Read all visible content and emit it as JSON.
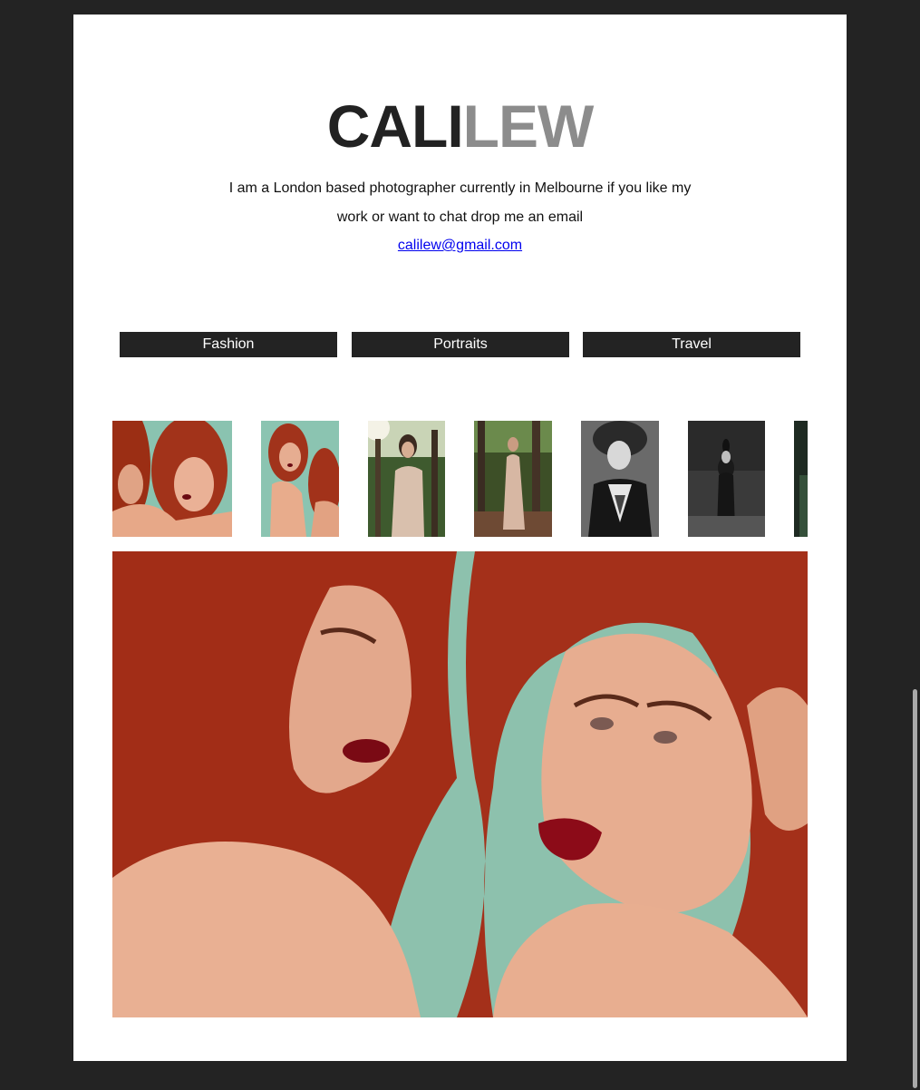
{
  "header": {
    "logo_first": "CALI",
    "logo_second": "LEW",
    "intro_line1": "I am a London based photographer currently in Melbourne if you like my",
    "intro_line2": "work or want to chat drop me an email",
    "email": "calilew@gmail.com"
  },
  "nav": {
    "items": [
      {
        "label": "Fashion"
      },
      {
        "label": "Portraits"
      },
      {
        "label": "Travel"
      }
    ]
  },
  "colors": {
    "page_background": "#232323",
    "content_background": "#ffffff",
    "logo_dark": "#222222",
    "logo_light": "#8c8c8c",
    "button_background": "#232323",
    "link": "#0000ee"
  }
}
